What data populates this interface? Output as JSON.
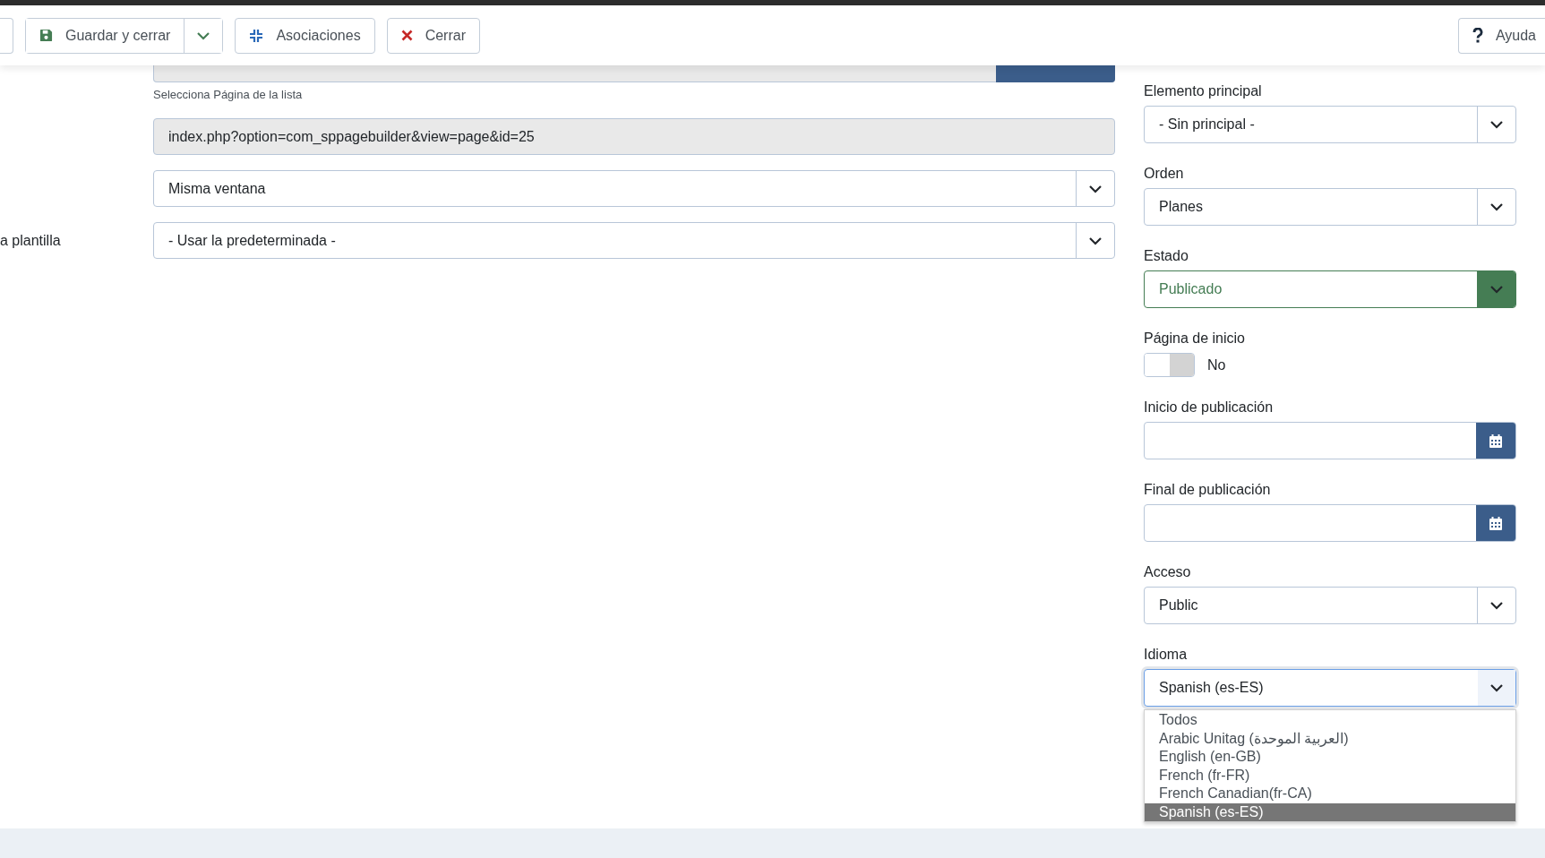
{
  "toolbar": {
    "buttons": [
      {
        "kind": "partial"
      },
      {
        "kind": "save",
        "label": "Guardar y cerrar"
      },
      {
        "kind": "associations",
        "label": "Asociaciones"
      },
      {
        "kind": "close",
        "label": "Cerrar"
      }
    ],
    "help": {
      "label": "Ayuda"
    }
  },
  "main": {
    "hint": "Selecciona Página de la lista",
    "fields": [
      {
        "kind": "text",
        "value": "index.php?option=com_sppagebuilder&view=page&id=25",
        "disabled": true
      },
      {
        "kind": "select",
        "value": "Misma ventana"
      },
      {
        "kind": "select",
        "label": "a plantilla",
        "value": "- Usar la predeterminada -"
      }
    ]
  },
  "sidebar": {
    "fields": [
      {
        "kind": "select",
        "label": "Elemento principal",
        "value": "- Sin principal -",
        "expanded": false
      },
      {
        "kind": "select",
        "label": "Orden",
        "value": "Planes",
        "expanded": false
      },
      {
        "kind": "status-select",
        "label": "Estado",
        "value": "Publicado",
        "expanded": false
      },
      {
        "kind": "toggle",
        "label": "Página de inicio",
        "on": false,
        "state_label": "No"
      },
      {
        "kind": "date",
        "label": "Inicio de publicación"
      },
      {
        "kind": "date",
        "label": "Final de publicación"
      },
      {
        "kind": "select",
        "label": "Acceso",
        "value": "Public",
        "expanded": false
      },
      {
        "kind": "select",
        "label": "Idioma",
        "value": "Spanish (es-ES)",
        "expanded": true,
        "options": [
          {
            "label": "Todos",
            "selected": false
          },
          {
            "label": "Arabic Unitag (العربية الموحدة)",
            "selected": false
          },
          {
            "label": "English (en-GB)",
            "selected": false
          },
          {
            "label": "French (fr-FR)",
            "selected": false
          },
          {
            "label": "French Canadian(fr-CA)",
            "selected": false
          },
          {
            "label": "Spanish (es-ES)",
            "selected": true
          }
        ]
      }
    ]
  }
}
